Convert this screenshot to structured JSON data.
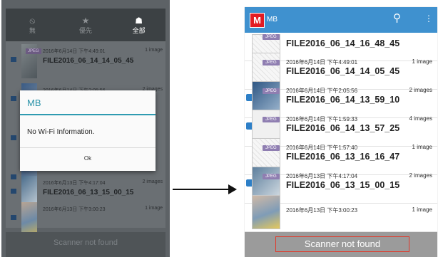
{
  "left": {
    "toolbar": [
      {
        "label": "無",
        "icon": "⦸",
        "icon_name": "prohibited-icon",
        "active": false
      },
      {
        "label": "優先",
        "icon": "★",
        "icon_name": "star-icon",
        "active": false
      },
      {
        "label": "全部",
        "icon": "☗",
        "icon_name": "tag-icon",
        "active": true
      }
    ],
    "entries": [
      {
        "meta": "2016年6月14日 下午4:49:01",
        "count": "1 image",
        "name": "FILE2016_06_14_14_05_45"
      },
      {
        "meta": "2016年6月14日 下午2:05:56",
        "count": "2 images",
        "name": ""
      },
      {
        "meta": "",
        "count": "",
        "name": ""
      },
      {
        "meta": "",
        "count": "",
        "name": ""
      },
      {
        "meta": "2016年6月13日 下午4:17:04",
        "count": "2 images",
        "name": "FILE2016_06_13_15_00_15"
      },
      {
        "meta": "2016年6月13日 下午3:00:23",
        "count": "1 image",
        "name": ""
      }
    ],
    "badge": "JPEG",
    "scanner": "Scanner not found"
  },
  "dialog": {
    "title": "MB",
    "message": "No Wi-Fi Information.",
    "ok": "Ok"
  },
  "right": {
    "app_title": "MB",
    "logo_letter": "M",
    "badge": "JPEG",
    "rows": [
      {
        "meta": "",
        "count": "",
        "name": "FILE2016_06_14_16_48_45"
      },
      {
        "meta": "2016年6月14日 下午4:49:01",
        "count": "1 image",
        "name": "FILE2016_06_14_14_05_45"
      },
      {
        "meta": "2016年6月14日 下午2:05:56",
        "count": "2 images",
        "name": "FILE2016_06_14_13_59_10"
      },
      {
        "meta": "2016年6月14日 下午1:59:33",
        "count": "4 images",
        "name": "FILE2016_06_14_13_57_25"
      },
      {
        "meta": "2016年6月14日 下午1:57:40",
        "count": "1 image",
        "name": "FILE2016_06_13_16_16_47"
      },
      {
        "meta": "2016年6月13日 下午4:17:04",
        "count": "2 images",
        "name": "FILE2016_06_13_15_00_15"
      },
      {
        "meta": "2016年6月13日 下午3:00:23",
        "count": "1 image",
        "name": ""
      }
    ],
    "scanner": "Scanner not found"
  },
  "colors": {
    "header_blue": "#3f91cf",
    "logo_red": "#e21b22",
    "dialog_accent": "#2f9bb1",
    "scanner_outline": "#e03a2c"
  }
}
